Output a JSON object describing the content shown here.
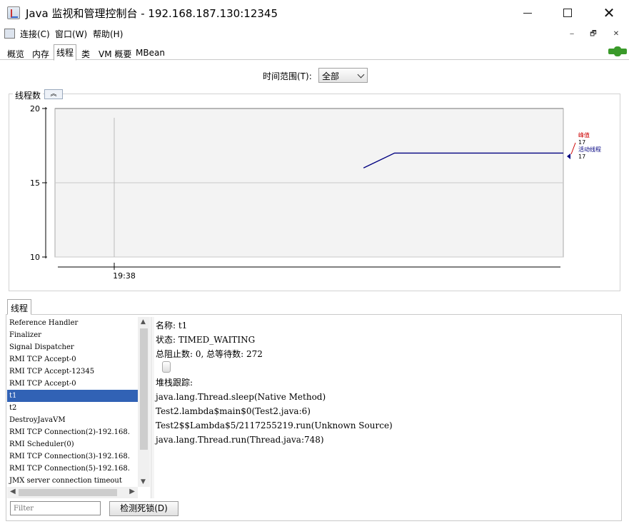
{
  "window": {
    "title": "Java 监视和管理控制台 - 192.168.187.130:12345",
    "minimize": "",
    "maximize": "",
    "close": "✕"
  },
  "menu": {
    "items": [
      "连接(C)",
      "窗口(W)",
      "帮助(H)"
    ],
    "mdi_buttons": [
      "‒",
      "🗗",
      "✕"
    ]
  },
  "tabs": [
    "概览",
    "内存",
    "线程",
    "类",
    "VM 概要",
    "MBean"
  ],
  "active_tab": "线程",
  "time_range": {
    "label": "时间范围(T):",
    "value": "全部"
  },
  "chart_panel": {
    "title": "线程数",
    "collapse_icon": "chevron-up-icon"
  },
  "chart_data": {
    "type": "line",
    "title": "线程数",
    "xlabel": "",
    "ylabel": "",
    "ylim": [
      10,
      20
    ],
    "yticks": [
      "20",
      "15",
      "10"
    ],
    "xticks": [
      "19:38"
    ],
    "grid": true,
    "legend": [
      {
        "name": "峰值",
        "value": "17",
        "color": "#cc0000"
      },
      {
        "name": "活动线程",
        "value": "17",
        "color": "#000080"
      }
    ],
    "series": [
      {
        "name": "活动线程",
        "color": "#000080",
        "points": [
          [
            0.607,
            16
          ],
          [
            0.668,
            17
          ],
          [
            1.0,
            17
          ]
        ]
      }
    ]
  },
  "threads_tab": "线程",
  "thread_list": [
    "Reference Handler",
    "Finalizer",
    "Signal Dispatcher",
    "RMI TCP Accept-0",
    "RMI TCP Accept-12345",
    "RMI TCP Accept-0",
    "t1",
    "t2",
    "DestroyJavaVM",
    "RMI TCP Connection(2)-192.168.",
    "RMI Scheduler(0)",
    "RMI TCP Connection(3)-192.168.",
    "RMI TCP Connection(5)-192.168.",
    "JMX server connection timeout"
  ],
  "selected_thread": "t1",
  "filter": {
    "placeholder": "Filter"
  },
  "deadlock_button": "检测死锁(D)",
  "details": {
    "name_line": "名称: t1",
    "state_line": "状态: TIMED_WAITING",
    "counts_line": "总阻止数: 0, 总等待数: 272",
    "stack_label": "堆栈跟踪:",
    "stack": [
      "java.lang.Thread.sleep(Native Method)",
      "Test2.lambda$main$0(Test2.java:6)",
      "Test2$$Lambda$5/2117255219.run(Unknown Source)",
      "java.lang.Thread.run(Thread.java:748)"
    ]
  }
}
